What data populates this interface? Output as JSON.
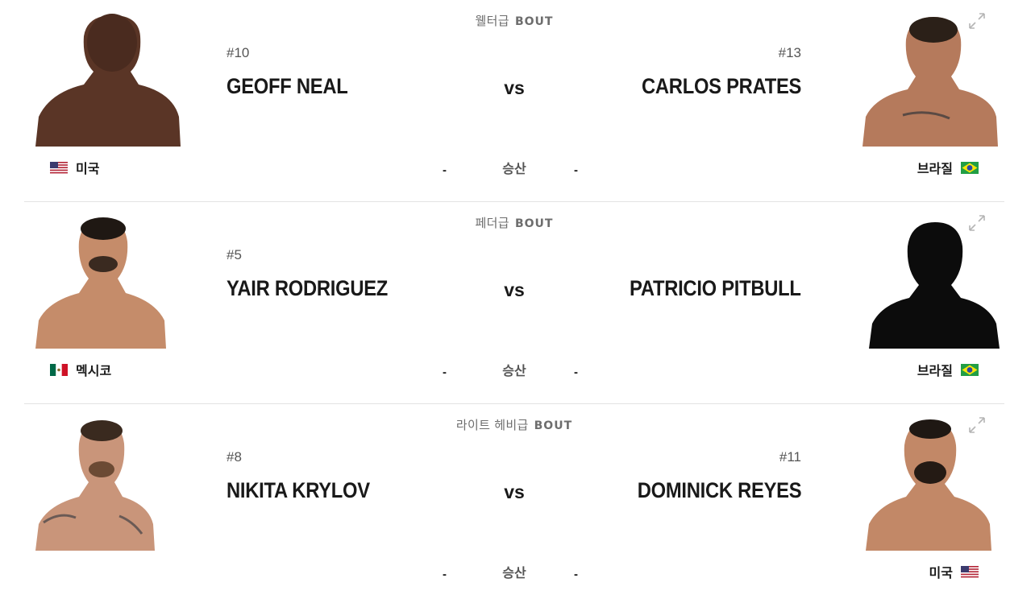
{
  "bouts": [
    {
      "weight_class": "웰터급",
      "bout_label": "BOUT",
      "vs_label": "vs",
      "result_label": "승산",
      "red": {
        "rank": "#10",
        "name": "GEOFF NEAL",
        "country": "미국",
        "flag": "usa-flag",
        "odds": "-"
      },
      "blue": {
        "rank": "#13",
        "name": "CARLOS PRATES",
        "country": "브라질",
        "flag": "brazil-flag",
        "odds": "-"
      }
    },
    {
      "weight_class": "페더급",
      "bout_label": "BOUT",
      "vs_label": "vs",
      "result_label": "승산",
      "red": {
        "rank": "#5",
        "name": "YAIR RODRIGUEZ",
        "country": "멕시코",
        "flag": "mexico-flag",
        "odds": "-"
      },
      "blue": {
        "rank": "",
        "name": "PATRICIO PITBULL",
        "country": "브라질",
        "flag": "brazil-flag",
        "odds": "-"
      }
    },
    {
      "weight_class": "라이트 헤비급",
      "bout_label": "BOUT",
      "vs_label": "vs",
      "result_label": "승산",
      "red": {
        "rank": "#8",
        "name": "NIKITA KRYLOV",
        "country": "",
        "flag": "",
        "odds": "-"
      },
      "blue": {
        "rank": "#11",
        "name": "DOMINICK REYES",
        "country": "미국",
        "flag": "usa-flag",
        "odds": "-"
      }
    }
  ],
  "colors": {
    "text": "#191919",
    "muted": "#6d6d6d",
    "divider": "#e3e3e3",
    "skin": "#b7775a",
    "silhouette": "#0c0c0c"
  }
}
